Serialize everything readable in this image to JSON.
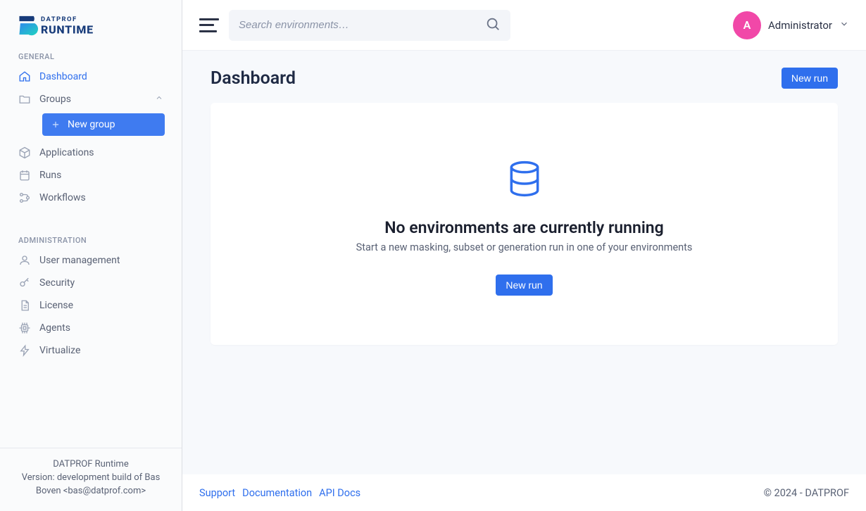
{
  "logo": {
    "topline": "DATPROF",
    "bottomline": "RUNTIME"
  },
  "sidebar": {
    "section_general": "GENERAL",
    "section_admin": "ADMINISTRATION",
    "items_general": [
      {
        "label": "Dashboard"
      },
      {
        "label": "Groups"
      },
      {
        "label": "Applications"
      },
      {
        "label": "Runs"
      },
      {
        "label": "Workflows"
      }
    ],
    "new_group_label": "New group",
    "items_admin": [
      {
        "label": "User management"
      },
      {
        "label": "Security"
      },
      {
        "label": "License"
      },
      {
        "label": "Agents"
      },
      {
        "label": "Virtualize"
      }
    ],
    "footer_line1": "DATPROF Runtime",
    "footer_line2": "Version: development build of Bas Boven <bas@datprof.com>"
  },
  "search": {
    "placeholder": "Search environments…"
  },
  "user": {
    "initial": "A",
    "name": "Administrator"
  },
  "page": {
    "title": "Dashboard",
    "new_run_label": "New run",
    "empty_title": "No environments are currently running",
    "empty_sub": "Start a new masking, subset or generation run in one of your environments"
  },
  "footer": {
    "support": "Support",
    "documentation": "Documentation",
    "api_docs": "API Docs",
    "copyright": "© 2024 - DATPROF"
  }
}
